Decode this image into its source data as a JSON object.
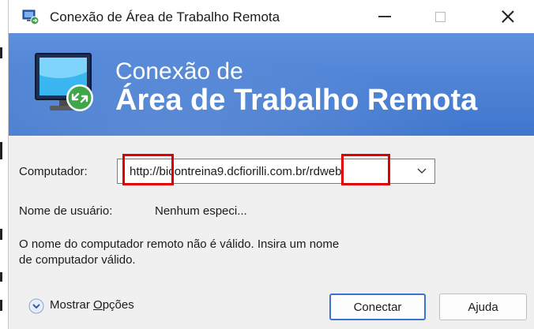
{
  "window": {
    "title": "Conexão de Área de Trabalho Remota",
    "icon": "remote-desktop-icon"
  },
  "banner": {
    "line1": "Conexão de",
    "line2": "Área de Trabalho Remota",
    "icon": "remote-desktop-monitor-icon"
  },
  "form": {
    "computer_label": "Computador:",
    "computer_value": "http://bicontreina9.dcfiorilli.com.br/rdweb",
    "username_label": "Nome de usuário:",
    "username_value": "Nenhum especi...",
    "error_line1": "O nome do computador remoto não é válido. Insira um nome",
    "error_line2": "de computador válido."
  },
  "footer": {
    "options_prefix": "Mostrar ",
    "options_accel": "O",
    "options_suffix": "pções",
    "connect_label": "Conectar",
    "help_label": "Ajuda"
  },
  "colors": {
    "banner": "#4a7fd3",
    "highlight": "#e00000",
    "focus_border": "#3b73cf"
  }
}
